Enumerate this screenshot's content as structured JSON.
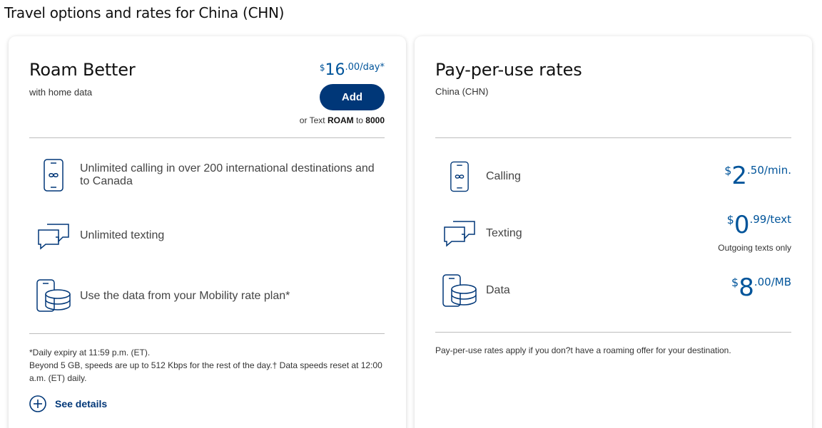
{
  "page": {
    "title": "Travel options and rates for China (CHN)"
  },
  "roam_better": {
    "title": "Roam Better",
    "subtitle": "with home data",
    "price": {
      "currency": "$",
      "whole": "16",
      "rest": ".00/day*"
    },
    "add_label": "Add",
    "text_prefix": "or Text ",
    "text_keyword": "ROAM",
    "text_mid": " to ",
    "text_number": "8000",
    "features": [
      {
        "icon": "phone-infinity-icon",
        "text": "Unlimited calling in over 200 international destinations and to Canada"
      },
      {
        "icon": "chat-bubbles-icon",
        "text": "Unlimited texting"
      },
      {
        "icon": "phone-data-icon",
        "text": "Use the data from your Mobility rate plan*"
      }
    ],
    "footnote_line1": "*Daily expiry at 11:59 p.m. (ET).",
    "footnote_line2": "Beyond 5 GB, speeds are up to 512 Kbps for the rest of the day.† Data speeds reset at 12:00 a.m. (ET) daily.",
    "see_details_label": "See details"
  },
  "pay_per_use": {
    "title": "Pay-per-use rates",
    "subtitle": "China (CHN)",
    "rates": [
      {
        "icon": "phone-infinity-icon",
        "label": "Calling",
        "currency": "$",
        "whole": "2",
        "rest": ".50/min.",
        "note": ""
      },
      {
        "icon": "chat-bubbles-icon",
        "label": "Texting",
        "currency": "$",
        "whole": "0",
        "rest": ".99/text",
        "note": "Outgoing texts only"
      },
      {
        "icon": "phone-data-icon",
        "label": "Data",
        "currency": "$",
        "whole": "8",
        "rest": ".00/MB",
        "note": ""
      }
    ],
    "footer_note": "Pay-per-use rates apply if you don?t have a roaming offer for your destination."
  },
  "colors": {
    "brand_blue": "#00549a",
    "button_navy": "#003778",
    "icon_blue": "#003778"
  }
}
